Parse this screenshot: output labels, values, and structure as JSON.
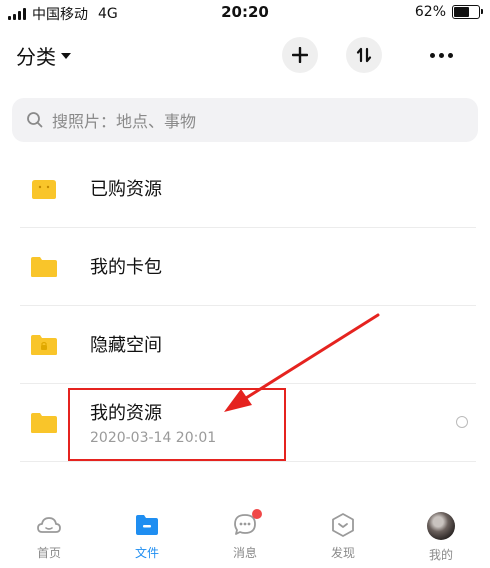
{
  "status_bar": {
    "carrier": "中国移动",
    "network": "4G",
    "time": "20:20",
    "battery": "62%",
    "battery_level": 0.62
  },
  "header": {
    "title": "分类",
    "add_icon": "plus-icon",
    "sort_icon": "sort-icon",
    "more_icon": "more-icon"
  },
  "search": {
    "placeholder": "搜照片：地点、事物"
  },
  "folders": [
    {
      "label": "已购资源",
      "icon": "shopping-bag-folder-icon"
    },
    {
      "label": "我的卡包",
      "icon": "folder-icon"
    },
    {
      "label": "隐藏空间",
      "icon": "locked-folder-icon"
    },
    {
      "label": "我的资源",
      "subtitle": "2020-03-14 20:01",
      "icon": "folder-icon"
    }
  ],
  "tabs": [
    {
      "label": "首页",
      "icon": "home-cloud-icon"
    },
    {
      "label": "文件",
      "icon": "file-folder-icon",
      "active": true
    },
    {
      "label": "消息",
      "icon": "message-icon",
      "badge": true
    },
    {
      "label": "发现",
      "icon": "discover-icon"
    },
    {
      "label": "我的",
      "icon": "avatar"
    }
  ],
  "colors": {
    "accent": "#1f8ef1",
    "folder": "#f9c52a",
    "annotation": "#e5231f",
    "badge": "#f04848"
  }
}
